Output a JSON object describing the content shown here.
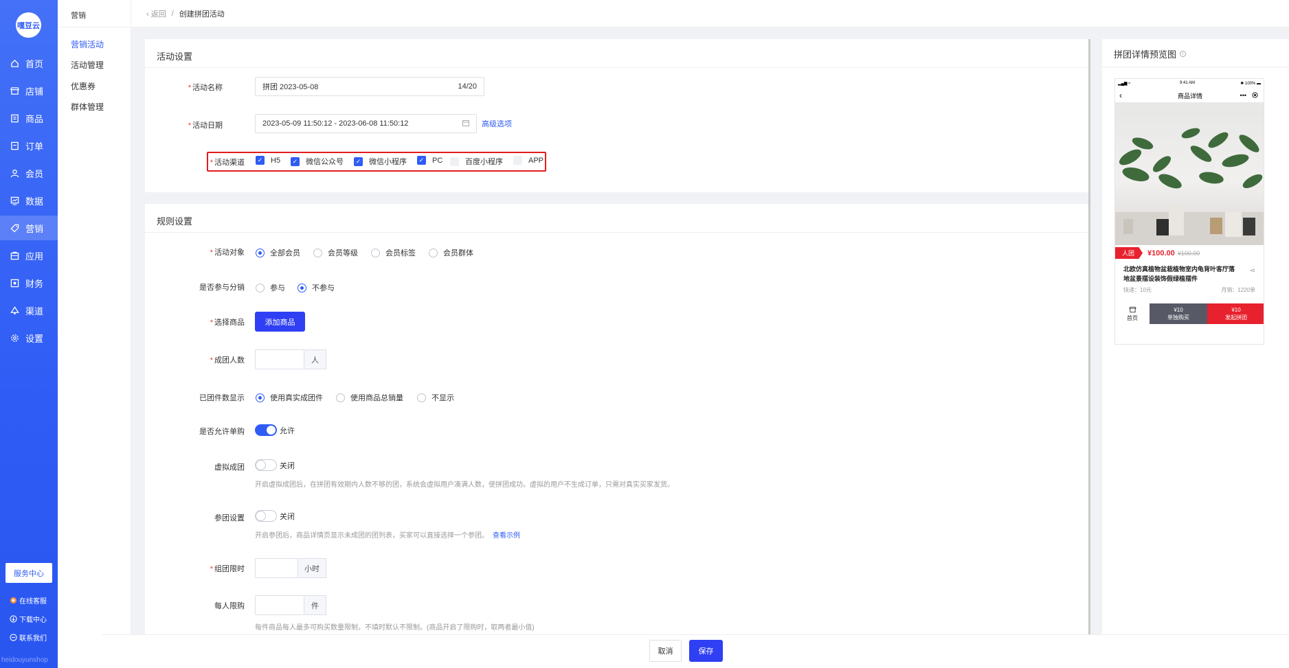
{
  "app": {
    "logo": "嘿豆云",
    "watermark": "heidouyunshop"
  },
  "sidebar": {
    "items": [
      {
        "label": "首页",
        "icon": "home-icon"
      },
      {
        "label": "店铺",
        "icon": "shop-icon"
      },
      {
        "label": "商品",
        "icon": "goods-icon"
      },
      {
        "label": "订单",
        "icon": "order-icon"
      },
      {
        "label": "会员",
        "icon": "member-icon"
      },
      {
        "label": "数据",
        "icon": "chart-icon"
      },
      {
        "label": "营销",
        "icon": "tag-icon"
      },
      {
        "label": "应用",
        "icon": "app-icon"
      },
      {
        "label": "财务",
        "icon": "finance-icon"
      },
      {
        "label": "渠道",
        "icon": "channel-icon"
      },
      {
        "label": "设置",
        "icon": "gear-icon"
      }
    ],
    "active": "营销",
    "service_center": "服务中心",
    "links": [
      {
        "label": "在线客服",
        "icon": "chat-icon"
      },
      {
        "label": "下载中心",
        "icon": "download-icon"
      },
      {
        "label": "联系我们",
        "icon": "contact-icon"
      }
    ]
  },
  "subnav": {
    "title": "营销",
    "items": [
      "营销活动",
      "活动管理",
      "优惠券",
      "群体管理"
    ],
    "active": "营销活动"
  },
  "breadcrumb": {
    "back": "返回",
    "current": "创建拼团活动"
  },
  "activity_settings": {
    "title": "活动设置",
    "name_label": "活动名称",
    "name_value": "拼团 2023-05-08",
    "name_count": "14/20",
    "date_label": "活动日期",
    "date_value": "2023-05-09 11:50:12 - 2023-06-08 11:50:12",
    "advanced_link": "高级选项",
    "channel_label": "活动渠道",
    "channels": [
      {
        "label": "H5",
        "checked": true
      },
      {
        "label": "微信公众号",
        "checked": true
      },
      {
        "label": "微信小程序",
        "checked": true
      },
      {
        "label": "PC",
        "checked": true
      },
      {
        "label": "百度小程序",
        "checked": false
      },
      {
        "label": "APP",
        "checked": false
      }
    ]
  },
  "rule_settings": {
    "title": "规则设置",
    "target_label": "活动对象",
    "target_options": [
      "全部会员",
      "会员等级",
      "会员标签",
      "会员群体"
    ],
    "target_selected": "全部会员",
    "distribution_label": "是否参与分销",
    "distribution_options": [
      "参与",
      "不参与"
    ],
    "distribution_selected": "不参与",
    "goods_label": "选择商品",
    "add_goods_button": "添加商品",
    "group_size_label": "成团人数",
    "group_size_value": "",
    "group_size_unit": "人",
    "display_label": "已团件数显示",
    "display_options": [
      "使用真实成团件",
      "使用商品总销量",
      "不显示"
    ],
    "display_selected": "使用真实成团件",
    "single_buy_label": "是否允许单购",
    "single_buy_state": "允许",
    "virtual_label": "虚拟成团",
    "virtual_state": "关闭",
    "virtual_hint": "开启虚拟成团后，在拼团有效期内人数不够的团，系统会虚拟用户凑满人数，使拼团成功。虚拟的用户不生成订单，只需对真实买家发货。",
    "join_label": "参团设置",
    "join_state": "关闭",
    "join_hint": "开启参团后，商品详情页显示未成团的团列表，买家可以直接选择一个参团。",
    "join_example_link": "查看示例",
    "time_limit_label": "组团限时",
    "time_limit_value": "",
    "time_limit_unit": "小时",
    "per_person_label": "每人限购",
    "per_person_value": "",
    "per_person_unit": "件",
    "per_person_hint": "每件商品每人最多可购买数量限制，不填时默认不限制。(商品开启了限购时，取两者最小值)"
  },
  "preview": {
    "title": "拼团详情预览图",
    "status_signal": "▂▄▆ ≈",
    "status_time": "9:41 AM",
    "status_battery": "✱ 100% ▬",
    "nav_title": "商品详情",
    "tag": "人团",
    "price": "¥100.00",
    "original_price": "¥100.00",
    "product_name": "北欧仿真植物盆栽植物室内龟背叶客厅落地盆景摆设装饰假绿植摆件",
    "shipping": "快递：10元",
    "monthly_sales": "月销：1220单",
    "home_label": "首页",
    "single_price": "¥10",
    "single_label": "单独购买",
    "group_price": "¥10",
    "group_label": "发起拼团"
  },
  "footer": {
    "cancel": "取消",
    "save": "保存"
  },
  "colors": {
    "primary": "#2f5cf5",
    "button": "#2f3ff3",
    "danger": "#e8212e",
    "highlight_border": "#e31b1b"
  }
}
